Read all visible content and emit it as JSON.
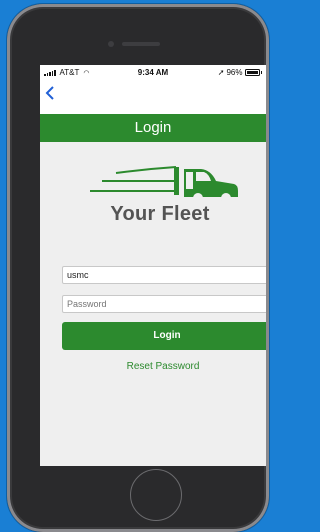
{
  "status_bar": {
    "carrier": "AT&T",
    "time": "9:34 AM",
    "battery": "96%"
  },
  "nav": {
    "back_icon": "chevron-left-icon"
  },
  "header": {
    "title": "Login"
  },
  "logo": {
    "text": "Your Fleet"
  },
  "form": {
    "username_value": "usmc",
    "password_placeholder": "Password",
    "login_label": "Login",
    "reset_label": "Reset Password"
  },
  "colors": {
    "accent_green": "#2c8a2e",
    "background_blue": "#1a7fd4",
    "link_blue": "#2160d6"
  }
}
